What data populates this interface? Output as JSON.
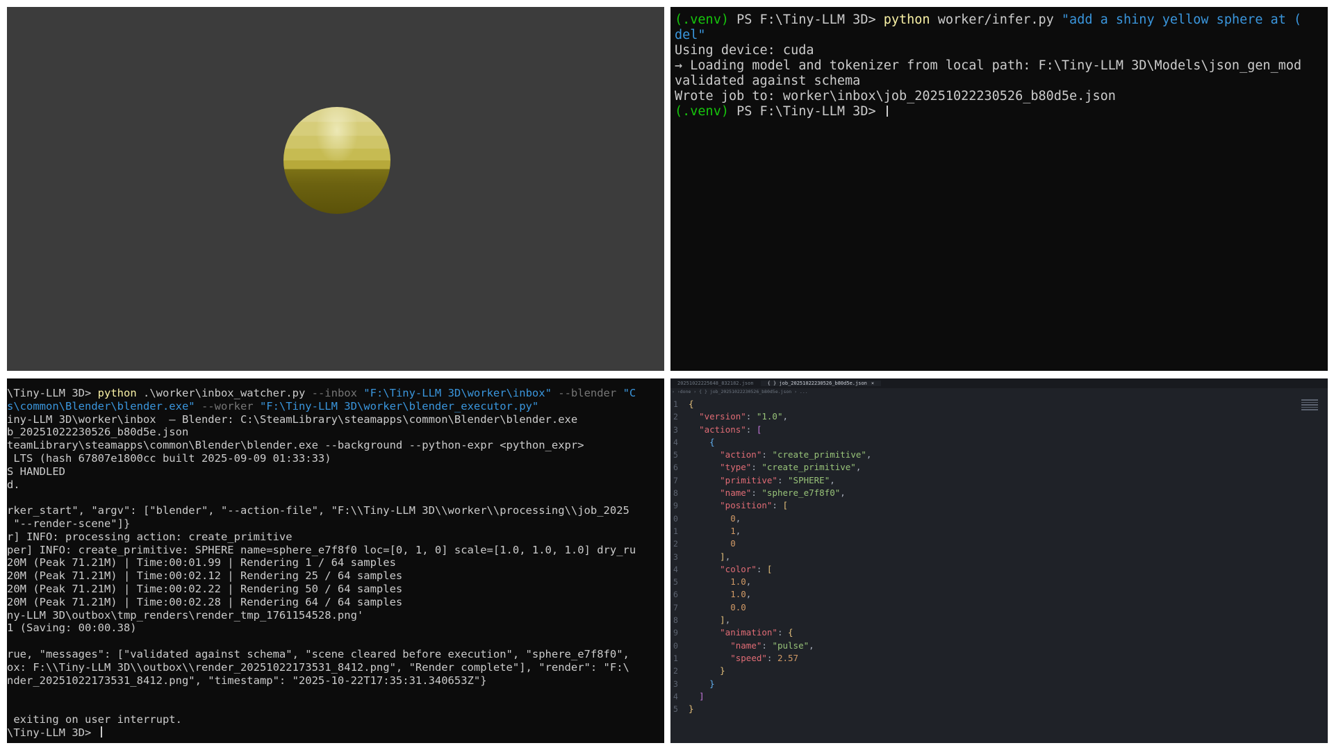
{
  "terminal_top": {
    "lines": [
      [
        {
          "t": "(.venv)",
          "c": "venv"
        },
        {
          "t": " PS F:\\Tiny-LLM 3D> ",
          "c": "plain"
        },
        {
          "t": "python",
          "c": "cmd"
        },
        {
          "t": " worker/infer.py ",
          "c": "plain"
        },
        {
          "t": "\"add a shiny yellow sphere at (",
          "c": "str"
        }
      ],
      [
        {
          "t": "del\"",
          "c": "str"
        }
      ],
      [
        {
          "t": "Using device: cuda",
          "c": "plain"
        }
      ],
      [
        {
          "t": "→ Loading model and tokenizer from local path: F:\\Tiny-LLM 3D\\Models\\json_gen_mod",
          "c": "plain"
        }
      ],
      [
        {
          "t": "validated against schema",
          "c": "plain"
        }
      ],
      [
        {
          "t": "Wrote job to: worker\\inbox\\job_20251022230526_b80d5e.json",
          "c": "plain"
        }
      ],
      [
        {
          "t": "(.venv)",
          "c": "venv"
        },
        {
          "t": " PS F:\\Tiny-LLM 3D> ",
          "c": "plain"
        }
      ]
    ]
  },
  "terminal_bottom": {
    "lines": [
      [
        {
          "t": "\\Tiny-LLM 3D> ",
          "c": "plain"
        },
        {
          "t": "python",
          "c": "cmd"
        },
        {
          "t": " .\\worker\\inbox_watcher.py ",
          "c": "plain"
        },
        {
          "t": "--inbox ",
          "c": "flag"
        },
        {
          "t": "\"F:\\Tiny-LLM 3D\\worker\\inbox\"",
          "c": "str"
        },
        {
          "t": " --blender ",
          "c": "flag"
        },
        {
          "t": "\"C",
          "c": "str"
        }
      ],
      [
        {
          "t": "s\\common\\Blender\\blender.exe\"",
          "c": "str"
        },
        {
          "t": " --worker ",
          "c": "flag"
        },
        {
          "t": "\"F:\\Tiny-LLM 3D\\worker\\blender_executor.py\"",
          "c": "str"
        }
      ],
      [
        {
          "t": "iny-LLM 3D\\worker\\inbox  — Blender: C:\\SteamLibrary\\steamapps\\common\\Blender\\blender.exe",
          "c": "plain"
        }
      ],
      [
        {
          "t": "b_20251022230526_b80d5e.json",
          "c": "plain"
        }
      ],
      [
        {
          "t": "teamLibrary\\steamapps\\common\\Blender\\blender.exe --background --python-expr <python_expr>",
          "c": "plain"
        }
      ],
      [
        {
          "t": " LTS (hash 67807e1800cc built 2025-09-09 01:33:33)",
          "c": "plain"
        }
      ],
      [
        {
          "t": "S HANDLED",
          "c": "plain"
        }
      ],
      [
        {
          "t": "d.",
          "c": "plain"
        }
      ],
      [
        {
          "t": "",
          "c": "plain"
        }
      ],
      [
        {
          "t": "rker_start\", \"argv\": [\"blender\", \"--action-file\", \"F:\\\\Tiny-LLM 3D\\\\worker\\\\processing\\\\job_2025",
          "c": "plain"
        }
      ],
      [
        {
          "t": " \"--render-scene\"]}",
          "c": "plain"
        }
      ],
      [
        {
          "t": "r] INFO: processing action: create_primitive",
          "c": "plain"
        }
      ],
      [
        {
          "t": "per] INFO: create_primitive: SPHERE name=sphere_e7f8f0 loc=[0, 1, 0] scale=[1.0, 1.0, 1.0] dry_ru",
          "c": "plain"
        }
      ],
      [
        {
          "t": "20M (Peak 71.21M) | Time:00:01.99 | Rendering 1 / 64 samples",
          "c": "plain"
        }
      ],
      [
        {
          "t": "20M (Peak 71.21M) | Time:00:02.12 | Rendering 25 / 64 samples",
          "c": "plain"
        }
      ],
      [
        {
          "t": "20M (Peak 71.21M) | Time:00:02.22 | Rendering 50 / 64 samples",
          "c": "plain"
        }
      ],
      [
        {
          "t": "20M (Peak 71.21M) | Time:00:02.28 | Rendering 64 / 64 samples",
          "c": "plain"
        }
      ],
      [
        {
          "t": "ny-LLM 3D\\outbox\\tmp_renders\\render_tmp_1761154528.png'",
          "c": "plain"
        }
      ],
      [
        {
          "t": "1 (Saving: 00:00.38)",
          "c": "plain"
        }
      ],
      [
        {
          "t": "",
          "c": "plain"
        }
      ],
      [
        {
          "t": "rue, \"messages\": [\"validated against schema\", \"scene cleared before execution\", \"sphere_e7f8f0\", ",
          "c": "plain"
        }
      ],
      [
        {
          "t": "ox: F:\\\\Tiny-LLM 3D\\\\outbox\\\\render_20251022173531_8412.png\", \"Render complete\"], \"render\": \"F:\\",
          "c": "plain"
        }
      ],
      [
        {
          "t": "nder_20251022173531_8412.png\", \"timestamp\": \"2025-10-22T17:35:31.340653Z\"}",
          "c": "plain"
        }
      ],
      [
        {
          "t": "",
          "c": "plain"
        }
      ],
      [
        {
          "t": "",
          "c": "plain"
        }
      ],
      [
        {
          "t": " exiting on user interrupt.",
          "c": "plain"
        }
      ],
      [
        {
          "t": "\\Tiny-LLM 3D> ",
          "c": "plain"
        }
      ]
    ]
  },
  "editor": {
    "tabs": [
      {
        "label": "20251022225648_832182.json",
        "active": false
      },
      {
        "label": "{ } job_20251022230526_b80d5e.json",
        "active": true,
        "close": "×"
      }
    ],
    "breadcrumb": "› ›done  ›  { } job_20251022230526_b80d5e.json  › ...",
    "lines": [
      {
        "n": "1",
        "segs": [
          {
            "t": "{",
            "c": "b1"
          }
        ]
      },
      {
        "n": "2",
        "segs": [
          {
            "t": "  ",
            "c": ""
          },
          {
            "t": "\"version\"",
            "c": "k"
          },
          {
            "t": ": ",
            "c": ""
          },
          {
            "t": "\"1.0\"",
            "c": "s"
          },
          {
            "t": ",",
            "c": ""
          }
        ]
      },
      {
        "n": "3",
        "segs": [
          {
            "t": "  ",
            "c": ""
          },
          {
            "t": "\"actions\"",
            "c": "k"
          },
          {
            "t": ": ",
            "c": ""
          },
          {
            "t": "[",
            "c": "b2"
          }
        ]
      },
      {
        "n": "4",
        "segs": [
          {
            "t": "    ",
            "c": ""
          },
          {
            "t": "{",
            "c": "b3"
          }
        ]
      },
      {
        "n": "5",
        "segs": [
          {
            "t": "      ",
            "c": ""
          },
          {
            "t": "\"action\"",
            "c": "k"
          },
          {
            "t": ": ",
            "c": ""
          },
          {
            "t": "\"create_primitive\"",
            "c": "s"
          },
          {
            "t": ",",
            "c": ""
          }
        ]
      },
      {
        "n": "6",
        "segs": [
          {
            "t": "      ",
            "c": ""
          },
          {
            "t": "\"type\"",
            "c": "k"
          },
          {
            "t": ": ",
            "c": ""
          },
          {
            "t": "\"create_primitive\"",
            "c": "s"
          },
          {
            "t": ",",
            "c": ""
          }
        ]
      },
      {
        "n": "7",
        "segs": [
          {
            "t": "      ",
            "c": ""
          },
          {
            "t": "\"primitive\"",
            "c": "k"
          },
          {
            "t": ": ",
            "c": ""
          },
          {
            "t": "\"SPHERE\"",
            "c": "s"
          },
          {
            "t": ",",
            "c": ""
          }
        ]
      },
      {
        "n": "8",
        "segs": [
          {
            "t": "      ",
            "c": ""
          },
          {
            "t": "\"name\"",
            "c": "k"
          },
          {
            "t": ": ",
            "c": ""
          },
          {
            "t": "\"sphere_e7f8f0\"",
            "c": "s"
          },
          {
            "t": ",",
            "c": ""
          }
        ]
      },
      {
        "n": "9",
        "segs": [
          {
            "t": "      ",
            "c": ""
          },
          {
            "t": "\"position\"",
            "c": "k"
          },
          {
            "t": ": ",
            "c": ""
          },
          {
            "t": "[",
            "c": "b1"
          }
        ]
      },
      {
        "n": "0",
        "segs": [
          {
            "t": "        ",
            "c": ""
          },
          {
            "t": "0",
            "c": "n"
          },
          {
            "t": ",",
            "c": ""
          }
        ]
      },
      {
        "n": "1",
        "segs": [
          {
            "t": "        ",
            "c": ""
          },
          {
            "t": "1",
            "c": "n"
          },
          {
            "t": ",",
            "c": ""
          }
        ]
      },
      {
        "n": "2",
        "segs": [
          {
            "t": "        ",
            "c": ""
          },
          {
            "t": "0",
            "c": "n"
          }
        ]
      },
      {
        "n": "3",
        "segs": [
          {
            "t": "      ",
            "c": ""
          },
          {
            "t": "]",
            "c": "b1"
          },
          {
            "t": ",",
            "c": ""
          }
        ]
      },
      {
        "n": "4",
        "segs": [
          {
            "t": "      ",
            "c": ""
          },
          {
            "t": "\"color\"",
            "c": "k"
          },
          {
            "t": ": ",
            "c": ""
          },
          {
            "t": "[",
            "c": "b1"
          }
        ]
      },
      {
        "n": "5",
        "segs": [
          {
            "t": "        ",
            "c": ""
          },
          {
            "t": "1.0",
            "c": "n"
          },
          {
            "t": ",",
            "c": ""
          }
        ]
      },
      {
        "n": "6",
        "segs": [
          {
            "t": "        ",
            "c": ""
          },
          {
            "t": "1.0",
            "c": "n"
          },
          {
            "t": ",",
            "c": ""
          }
        ]
      },
      {
        "n": "7",
        "segs": [
          {
            "t": "        ",
            "c": ""
          },
          {
            "t": "0.0",
            "c": "n"
          }
        ]
      },
      {
        "n": "8",
        "segs": [
          {
            "t": "      ",
            "c": ""
          },
          {
            "t": "]",
            "c": "b1"
          },
          {
            "t": ",",
            "c": ""
          }
        ]
      },
      {
        "n": "9",
        "segs": [
          {
            "t": "      ",
            "c": ""
          },
          {
            "t": "\"animation\"",
            "c": "k"
          },
          {
            "t": ": ",
            "c": ""
          },
          {
            "t": "{",
            "c": "b1"
          }
        ]
      },
      {
        "n": "0",
        "segs": [
          {
            "t": "        ",
            "c": ""
          },
          {
            "t": "\"name\"",
            "c": "k"
          },
          {
            "t": ": ",
            "c": ""
          },
          {
            "t": "\"pulse\"",
            "c": "s"
          },
          {
            "t": ",",
            "c": ""
          }
        ]
      },
      {
        "n": "1",
        "segs": [
          {
            "t": "        ",
            "c": ""
          },
          {
            "t": "\"speed\"",
            "c": "k"
          },
          {
            "t": ": ",
            "c": ""
          },
          {
            "t": "2.57",
            "c": "n"
          }
        ]
      },
      {
        "n": "2",
        "segs": [
          {
            "t": "      ",
            "c": ""
          },
          {
            "t": "}",
            "c": "b1"
          }
        ]
      },
      {
        "n": "3",
        "segs": [
          {
            "t": "    ",
            "c": ""
          },
          {
            "t": "}",
            "c": "b3"
          }
        ]
      },
      {
        "n": "4",
        "segs": [
          {
            "t": "  ",
            "c": ""
          },
          {
            "t": "]",
            "c": "b2"
          }
        ]
      },
      {
        "n": "5",
        "segs": [
          {
            "t": "}",
            "c": "b1"
          }
        ]
      }
    ]
  },
  "colors": {
    "viewport_bg": "#3c3c3c",
    "terminal_bg": "#0c0c0c",
    "editor_bg": "#1f2228",
    "sphere_yellow": "#cfc568"
  }
}
